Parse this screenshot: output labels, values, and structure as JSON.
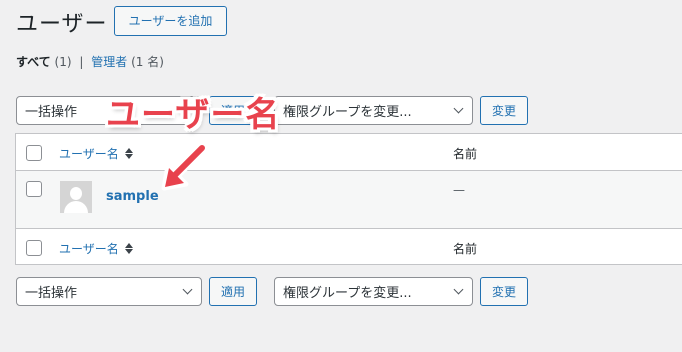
{
  "header": {
    "title": "ユーザー",
    "add_new_label": "ユーザーを追加"
  },
  "filters": {
    "all_label": "すべて",
    "all_count": "(1)",
    "admin_label": "管理者",
    "admin_count": "(1 名)"
  },
  "top_controls": {
    "bulk_action_selected": "一括操作",
    "apply_label": "適用",
    "role_selected": "権限グループを変更...",
    "change_label": "変更"
  },
  "table": {
    "columns": {
      "username": "ユーザー名",
      "name": "名前"
    },
    "rows": [
      {
        "username": "sample",
        "name": "—"
      }
    ]
  },
  "bottom_controls": {
    "bulk_action_selected": "一括操作",
    "apply_label": "適用",
    "role_selected": "権限グループを変更...",
    "change_label": "変更"
  },
  "annotation": {
    "text": "ユーザー名"
  },
  "colors": {
    "link": "#2271b1",
    "annotation": "#e8424d",
    "background": "#f0f0f1"
  }
}
